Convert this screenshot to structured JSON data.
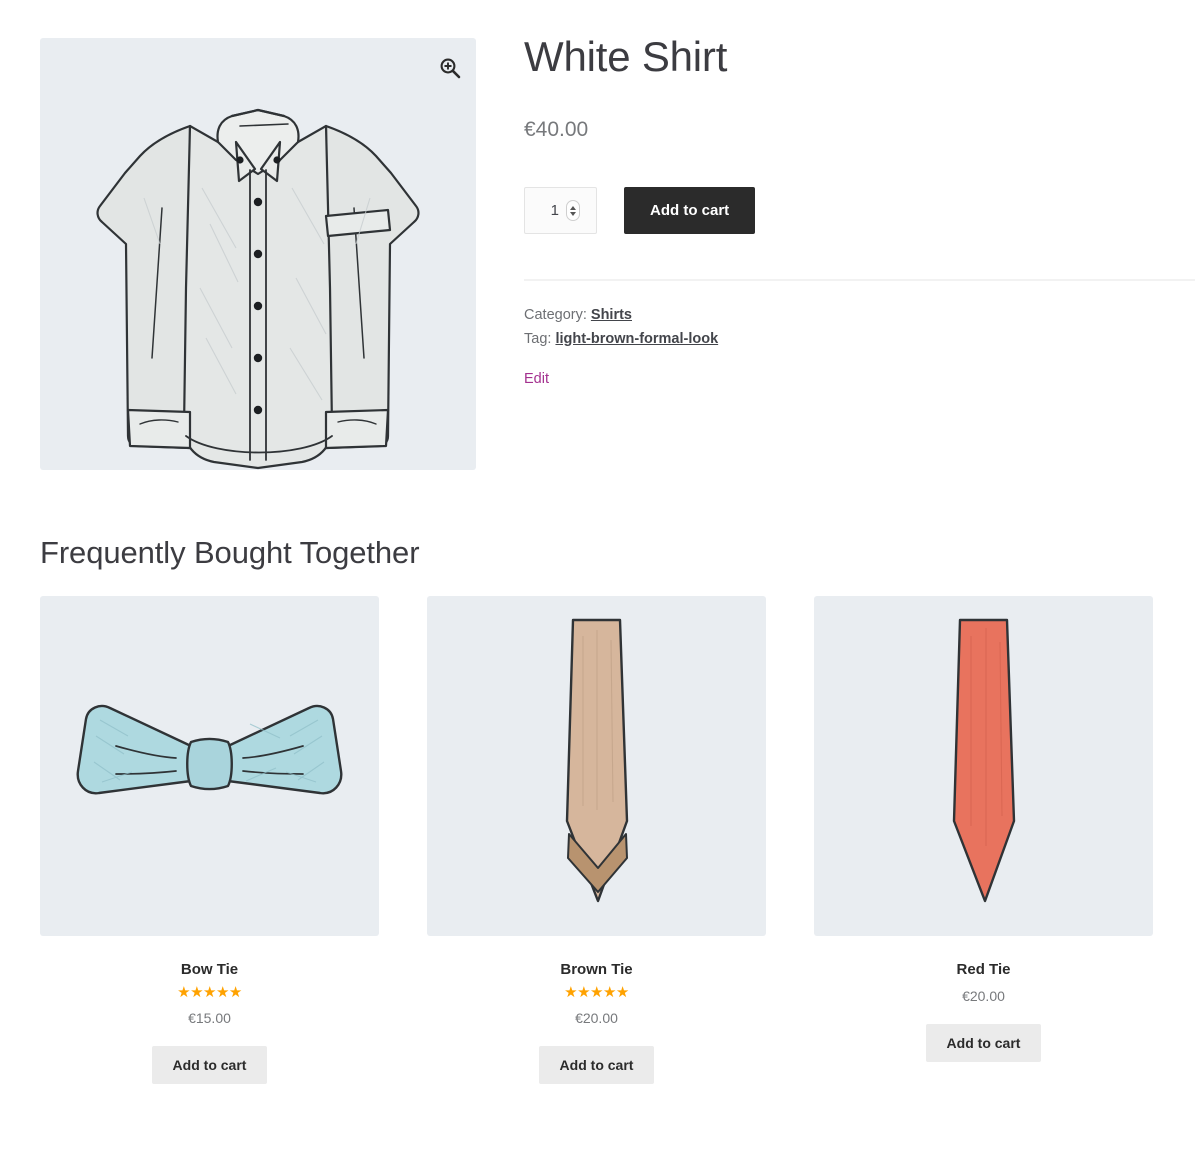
{
  "product": {
    "title": "White Shirt",
    "price": "€40.00",
    "zoom_icon": "magnifier-plus-icon",
    "image_alt": "white-dress-shirt-sketch",
    "quantity": "1",
    "add_to_cart_label": "Add to cart",
    "meta": {
      "category_label": "Category:",
      "category_value": "Shirts",
      "tag_label": "Tag:",
      "tag_value": "light-brown-formal-look"
    },
    "edit_label": "Edit"
  },
  "upsells": {
    "heading": "Frequently Bought Together",
    "products": [
      {
        "name": "Bow Tie",
        "price": "€15.00",
        "rating": 5,
        "stars": "★★★★★",
        "has_rating": true,
        "add_to_cart_label": "Add to cart",
        "image_alt": "light-blue-bow-tie-sketch"
      },
      {
        "name": "Brown Tie",
        "price": "€20.00",
        "rating": 5,
        "stars": "★★★★★",
        "has_rating": true,
        "add_to_cart_label": "Add to cart",
        "image_alt": "brown-necktie-sketch"
      },
      {
        "name": "Red Tie",
        "price": "€20.00",
        "rating": null,
        "stars": "",
        "has_rating": false,
        "add_to_cart_label": "Add to cart",
        "image_alt": "red-necktie-sketch"
      }
    ]
  },
  "colors": {
    "image_background": "#e9edf1",
    "button_dark": "#2b2b2b",
    "button_light": "#ebebeb",
    "star": "#ffa200",
    "edit_link": "#a4318f",
    "bow_tie": "#aed9e0",
    "brown_tie": "#d4b398",
    "red_tie": "#e8735e",
    "shirt": "#e3e6e5"
  }
}
